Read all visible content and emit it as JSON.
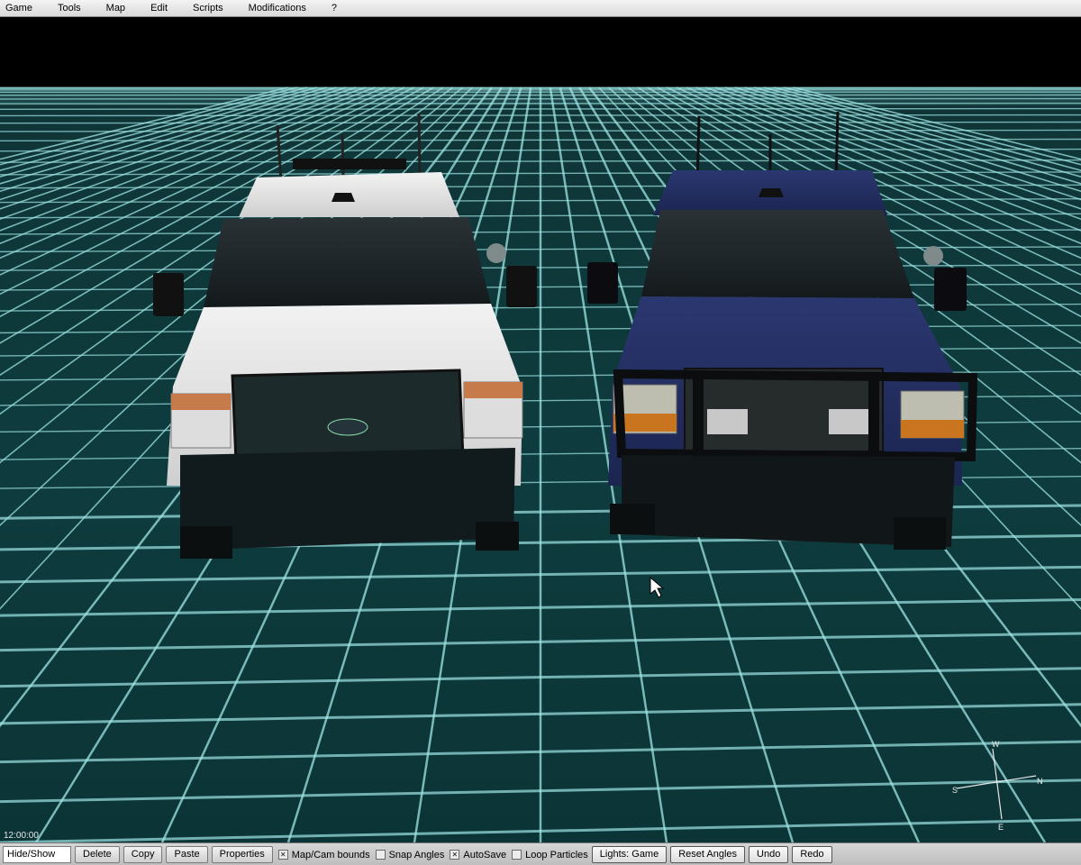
{
  "menu": {
    "items": [
      "Game",
      "Tools",
      "Map",
      "Edit",
      "Scripts",
      "Modifications",
      "?"
    ]
  },
  "viewport": {
    "clock": "12:00:00",
    "compass": {
      "n": "N",
      "s": "S",
      "e": "E",
      "w": "W"
    },
    "grid_color": "#9fe6e6",
    "ground_color": "#0e3a3c",
    "sky_color": "#000000",
    "vehicles": [
      {
        "name": "white pickup truck",
        "body_color": "#e9e9e9"
      },
      {
        "name": "blue pickup truck",
        "body_color": "#263261"
      }
    ]
  },
  "toolbar": {
    "hide_show": "Hide/Show",
    "delete": "Delete",
    "copy": "Copy",
    "paste": "Paste",
    "properties": "Properties",
    "map_cam_bounds": {
      "label": "Map/Cam bounds",
      "checked": true
    },
    "snap_angles": {
      "label": "Snap Angles",
      "checked": false
    },
    "autosave": {
      "label": "AutoSave",
      "checked": true
    },
    "loop_particles": {
      "label": "Loop Particles",
      "checked": false
    },
    "lights": "Lights: Game",
    "reset_angles": "Reset Angles",
    "undo": "Undo",
    "redo": "Redo"
  }
}
